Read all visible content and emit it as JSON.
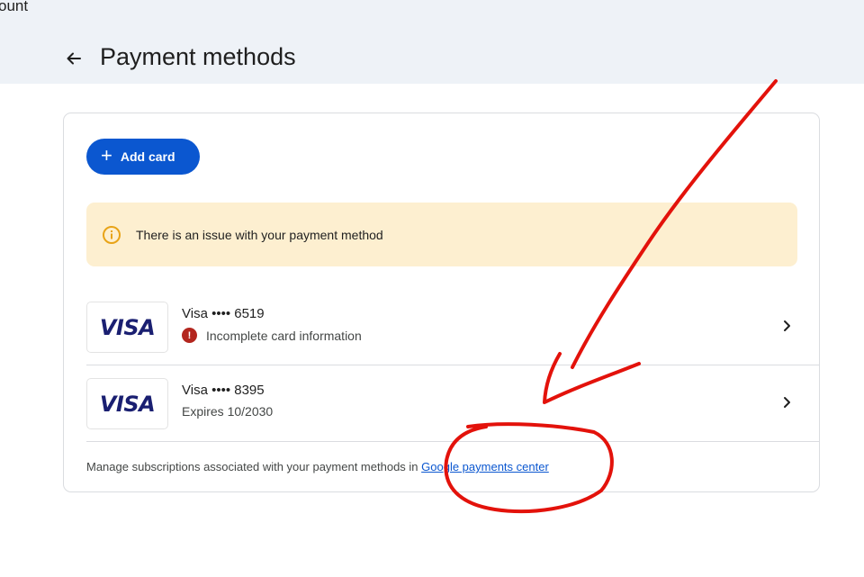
{
  "header": {
    "account_crumb": "ount",
    "title": "Payment methods"
  },
  "actions": {
    "add_card_label": "Add card"
  },
  "alert": {
    "message": "There is an issue with your payment method",
    "icon": "info-circle-icon",
    "color": "#fdefd0"
  },
  "payment_methods": [
    {
      "brand": "VISA",
      "name": "Visa •••• 6519",
      "status": "Incomplete card information",
      "error": true
    },
    {
      "brand": "VISA",
      "name": "Visa •••• 8395",
      "status": "Expires 10/2030",
      "error": false
    }
  ],
  "footer": {
    "text_prefix": "Manage subscriptions associated with your payment methods in ",
    "link_label": "Google payments center"
  },
  "colors": {
    "accent": "#0b57d0",
    "header_bg": "#eef2f7",
    "error": "#b3261e",
    "annotation": "#e3120b"
  }
}
